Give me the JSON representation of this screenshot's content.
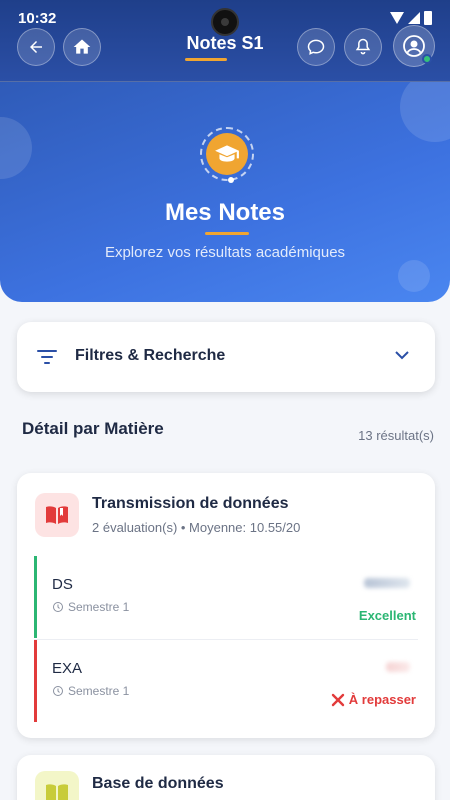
{
  "status_bar": {
    "time": "10:32"
  },
  "nav": {
    "title": "Notes S1"
  },
  "hero": {
    "title": "Mes Notes",
    "subtitle": "Explorez vos résultats académiques"
  },
  "filter": {
    "label": "Filtres & Recherche"
  },
  "section": {
    "title": "Détail par Matière",
    "result_count": "13 résultat(s)"
  },
  "subjects": [
    {
      "name": "Transmission de données",
      "meta": "2 évaluation(s) • Moyenne: 10.55/20",
      "icon": "book-icon",
      "evaluations": [
        {
          "type": "DS",
          "semester": "Semestre 1",
          "status": "Excellent",
          "status_color": "#2bb673",
          "bar_color": "#2bb673"
        },
        {
          "type": "EXA",
          "semester": "Semestre 1",
          "status": "À repasser",
          "status_color": "#e23b3b",
          "bar_color": "#e23b3b"
        }
      ]
    },
    {
      "name": "Base de données",
      "icon": "book-icon"
    }
  ],
  "colors": {
    "primary": "#2b4fa6",
    "accent": "#f0a531",
    "success": "#2bb673",
    "danger": "#e23b3b"
  }
}
